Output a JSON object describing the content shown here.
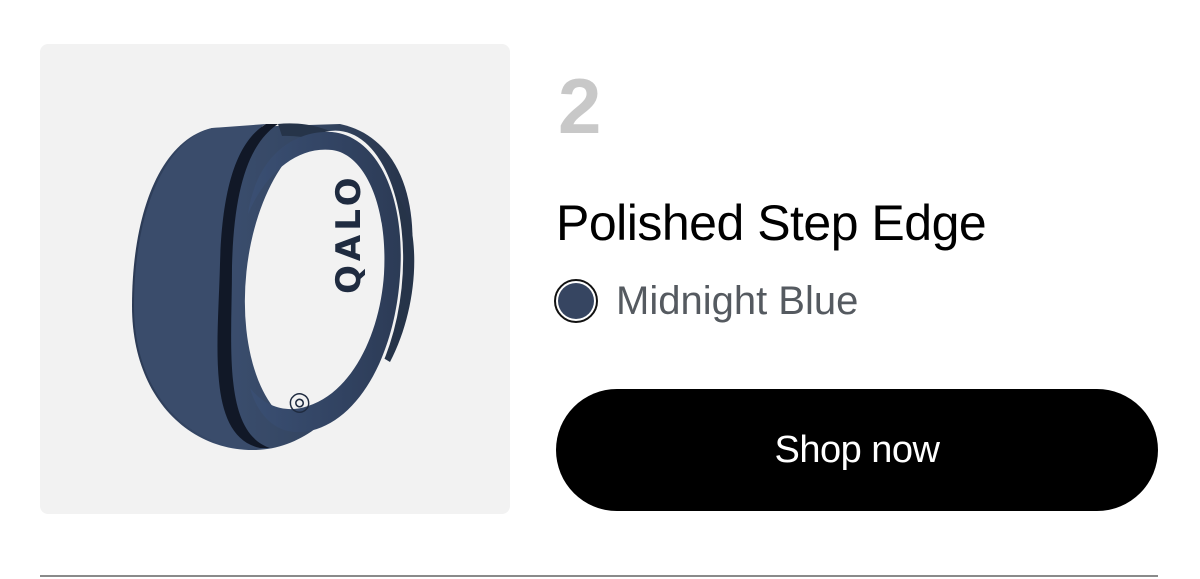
{
  "product": {
    "rank": "2",
    "title": "Polished Step Edge",
    "image_alt": "Polished Step Edge silicone ring",
    "ring_brand_text": "QALO",
    "color": {
      "name": "Midnight Blue",
      "swatch_hex": "#364561"
    },
    "cta_label": "Shop now"
  },
  "colors": {
    "image_background": "#f2f2f2",
    "rank_text": "#c8c8c8",
    "button_background": "#000000",
    "button_text": "#ffffff",
    "divider": "#8a8a8a"
  }
}
